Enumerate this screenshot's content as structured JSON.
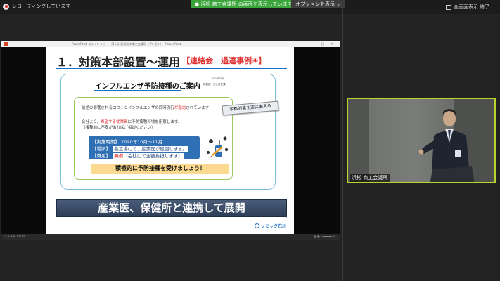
{
  "topbar": {
    "recording_label": "レコーディングしています",
    "share_banner": "● 浜松 商工会議所 の画面を表示しています",
    "view_options": "オプションを表示 ⌄",
    "fullscreen_label": "全画面表示 終了"
  },
  "window": {
    "title": "PowerPoint スライド ショー - [11月4日浜松市商工会議所（プレゼン）] - PowerPoint",
    "status_left": "スライド 12/13",
    "status_right": "▦ ▣ ─ ━━━━━ ＋"
  },
  "slide": {
    "title": "１．対策本部設置～運用",
    "tag": "【連絡会　過達事例④】",
    "notice": {
      "title": "インフルエンザ予防接種のご案内",
      "date": "2020年9月",
      "sender": "総務部・安全衛生課",
      "line1_prefix": "前述の影響されるコロナとインフルエンザの同時流行",
      "line1_red": "が懸念",
      "line1_suffix": "されています",
      "line2_prefix": "会社より、",
      "line2_red": "希望する従業員",
      "line2_suffix": "に予防接種の場を用意します。",
      "line3": "（接種前に不安があればご相談ください）",
      "schedule": {
        "row1": "【実施時期】 2020年10月～11月",
        "row2_label": "【場所】",
        "row2_value": "各工場にて：産業医が巡回します。",
        "row3_label": "【費用】",
        "row3_value_red": "無償",
        "row3_value": "（会社にて全額負担します）"
      },
      "cta": "積極的に予防接種を受けましょう！"
    },
    "callout": "本格的第２波に備える",
    "banner": "産業医、保健所と連携して展開",
    "logo": "ソミック石川",
    "page_number": "12"
  },
  "video": {
    "participant_name": "浜松 商工会議所"
  },
  "colors": {
    "accent_green": "#b9d42c",
    "share_banner_green": "#3aa53a",
    "title_blue": "#1a6fc4",
    "tag_red": "#e03030"
  }
}
